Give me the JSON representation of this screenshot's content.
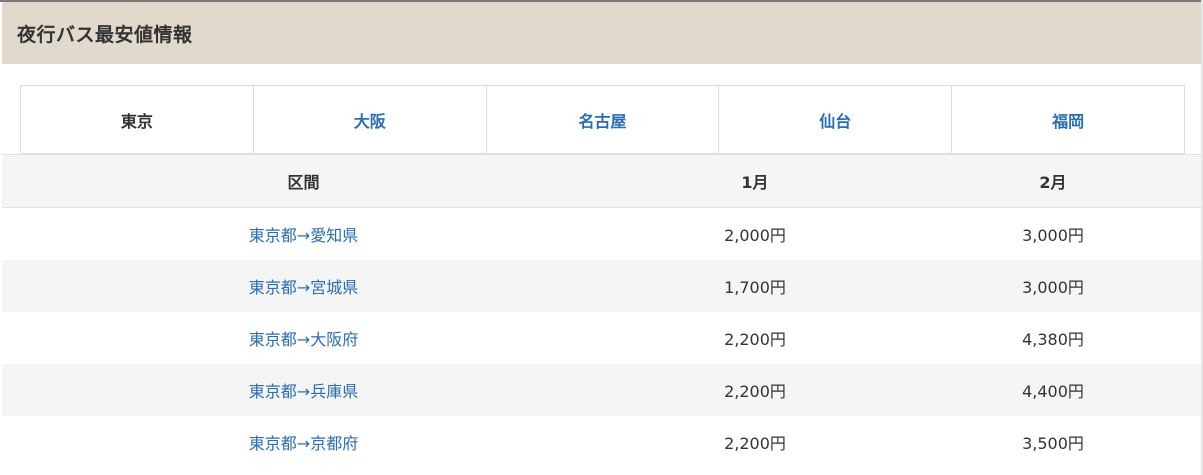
{
  "header": {
    "title": "夜行バス最安値情報"
  },
  "tabs": [
    "東京",
    "大阪",
    "名古屋",
    "仙台",
    "福岡"
  ],
  "table": {
    "headers": [
      "区間",
      "1月",
      "2月"
    ],
    "rows": [
      {
        "route": "東京都→愛知県",
        "jan": "2,000円",
        "feb": "3,000円"
      },
      {
        "route": "東京都→宮城県",
        "jan": "1,700円",
        "feb": "3,000円"
      },
      {
        "route": "東京都→大阪府",
        "jan": "2,200円",
        "feb": "4,380円"
      },
      {
        "route": "東京都→兵庫県",
        "jan": "2,200円",
        "feb": "4,400円"
      },
      {
        "route": "東京都→京都府",
        "jan": "2,200円",
        "feb": "3,500円"
      }
    ]
  }
}
